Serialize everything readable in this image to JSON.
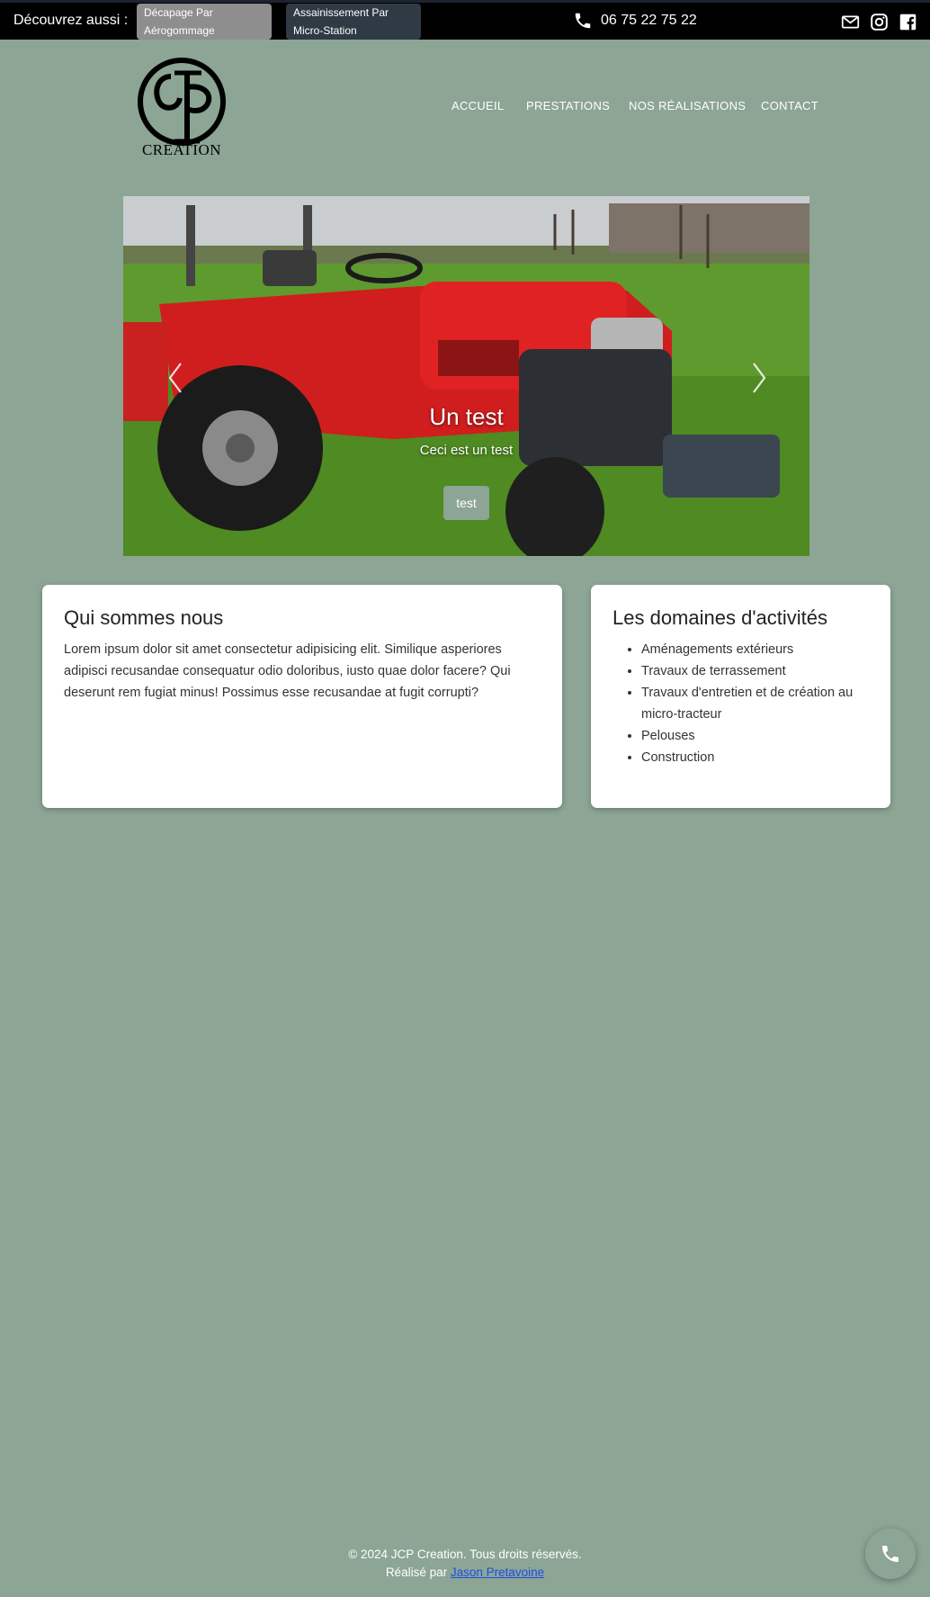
{
  "topbar": {
    "discover_label": "Découvrez aussi :",
    "tags": [
      {
        "line1": "Décapage Par",
        "line2": "Aérogommage"
      },
      {
        "line1": "Assainissement Par",
        "line2": "Micro-Station"
      }
    ],
    "phone": "06 75 22 75 22",
    "social_icons": [
      "mail-icon",
      "instagram-icon",
      "facebook-icon"
    ]
  },
  "header": {
    "logo_text": "CRÉATION",
    "nav": [
      "ACCUEIL",
      "PRESTATIONS",
      "NOS RÉALISATIONS",
      "CONTACT"
    ]
  },
  "carousel": {
    "slide_title": "Un test",
    "slide_subtitle": "Ceci est un test",
    "slide_button": "test"
  },
  "cards": {
    "about": {
      "title": "Qui sommes nous",
      "text": "Lorem ipsum dolor sit amet consectetur adipisicing elit. Similique asperiores adipisci recusandae consequatur odio doloribus, iusto quae dolor facere? Qui deserunt rem fugiat minus! Possimus esse recusandae at fugit corrupti?"
    },
    "activities": {
      "title": "Les domaines d'activités",
      "items": [
        "Aménagements extérieurs",
        "Travaux de terrassement",
        "Travaux d'entretien et de création au micro-tracteur",
        "Pelouses",
        "Construction"
      ]
    }
  },
  "footer": {
    "copyright": "© 2024 JCP Creation. Tous droits réservés.",
    "made_by_prefix": "Réalisé par ",
    "made_by_link": "Jason Pretavoine"
  },
  "colors": {
    "background": "#8ca595",
    "topbar": "#000000",
    "link": "#1c4ee8"
  }
}
